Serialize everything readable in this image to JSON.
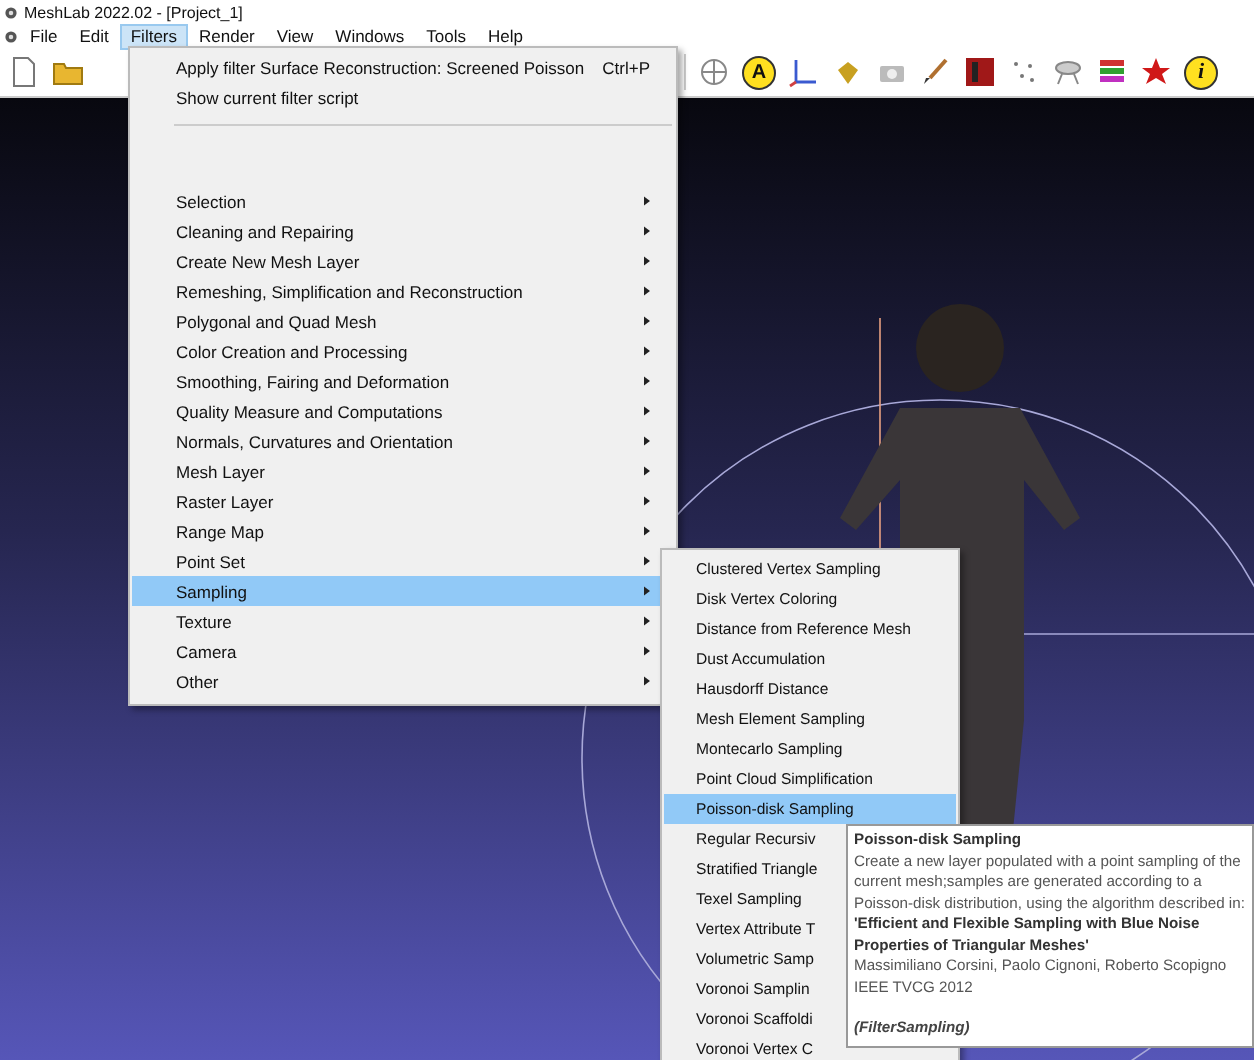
{
  "window": {
    "title": "MeshLab 2022.02 - [Project_1]"
  },
  "menubar": [
    {
      "label": "File",
      "selected": false
    },
    {
      "label": "Edit",
      "selected": false
    },
    {
      "label": "Filters",
      "selected": true
    },
    {
      "label": "Render",
      "selected": false
    },
    {
      "label": "View",
      "selected": false
    },
    {
      "label": "Windows",
      "selected": false
    },
    {
      "label": "Tools",
      "selected": false
    },
    {
      "label": "Help",
      "selected": false
    }
  ],
  "toolbar": {
    "letter_icons": [
      "A",
      "i"
    ]
  },
  "filters_menu": {
    "top_items": [
      {
        "label": "Apply filter Surface Reconstruction: Screened Poisson",
        "shortcut": "Ctrl+P"
      },
      {
        "label": "Show current filter script"
      }
    ],
    "items": [
      {
        "label": "Selection",
        "selected": false
      },
      {
        "label": "Cleaning and Repairing",
        "selected": false
      },
      {
        "label": "Create New Mesh Layer",
        "selected": false
      },
      {
        "label": "Remeshing, Simplification and Reconstruction",
        "selected": false
      },
      {
        "label": "Polygonal and Quad Mesh",
        "selected": false
      },
      {
        "label": "Color Creation and Processing",
        "selected": false
      },
      {
        "label": "Smoothing, Fairing and Deformation",
        "selected": false
      },
      {
        "label": "Quality Measure and Computations",
        "selected": false
      },
      {
        "label": "Normals, Curvatures and Orientation",
        "selected": false
      },
      {
        "label": "Mesh Layer",
        "selected": false
      },
      {
        "label": "Raster Layer",
        "selected": false
      },
      {
        "label": "Range Map",
        "selected": false
      },
      {
        "label": "Point Set",
        "selected": false
      },
      {
        "label": "Sampling",
        "selected": true
      },
      {
        "label": "Texture",
        "selected": false
      },
      {
        "label": "Camera",
        "selected": false
      },
      {
        "label": "Other",
        "selected": false
      }
    ]
  },
  "sampling_menu": [
    {
      "label": "Clustered Vertex Sampling",
      "selected": false
    },
    {
      "label": "Disk Vertex Coloring",
      "selected": false
    },
    {
      "label": "Distance from Reference Mesh",
      "selected": false
    },
    {
      "label": "Dust Accumulation",
      "selected": false
    },
    {
      "label": "Hausdorff Distance",
      "selected": false
    },
    {
      "label": "Mesh Element Sampling",
      "selected": false
    },
    {
      "label": "Montecarlo Sampling",
      "selected": false
    },
    {
      "label": "Point Cloud Simplification",
      "selected": false
    },
    {
      "label": "Poisson-disk Sampling",
      "selected": true
    },
    {
      "label": "Regular Recursiv",
      "selected": false
    },
    {
      "label": "Stratified Triangle",
      "selected": false
    },
    {
      "label": "Texel Sampling",
      "selected": false
    },
    {
      "label": "Vertex Attribute T",
      "selected": false
    },
    {
      "label": "Volumetric Samp",
      "selected": false
    },
    {
      "label": "Voronoi Samplin",
      "selected": false
    },
    {
      "label": "Voronoi Scaffoldi",
      "selected": false
    },
    {
      "label": "Voronoi Vertex C",
      "selected": false
    }
  ],
  "tooltip": [
    {
      "kind": "title",
      "text": "Poisson-disk Sampling"
    },
    {
      "kind": "body",
      "text": "Create a new layer populated with a point sampling of the current mesh;samples are generated according to a Poisson-disk distribution, using the algorithm described in:"
    },
    {
      "kind": "citation",
      "text": "'Efficient and Flexible Sampling with Blue Noise Properties of Triangular Meshes'"
    },
    {
      "kind": "body",
      "text": "Massimiliano Corsini, Paolo Cignoni, Roberto Scopigno"
    },
    {
      "kind": "body",
      "text": "IEEE TVCG 2012"
    },
    {
      "kind": "footer",
      "text": "(FilterSampling)"
    }
  ]
}
